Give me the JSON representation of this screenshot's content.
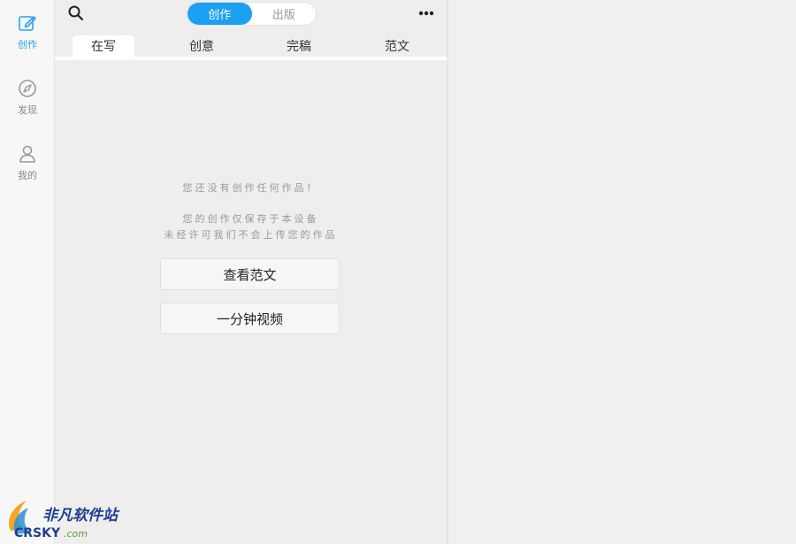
{
  "sidebar": {
    "items": [
      {
        "label": "创作",
        "icon": "edit-icon"
      },
      {
        "label": "发现",
        "icon": "compass-icon"
      },
      {
        "label": "我的",
        "icon": "user-icon"
      }
    ]
  },
  "topbar": {
    "segment": [
      "创作",
      "出版"
    ],
    "search_icon": "search-icon",
    "more_icon": "more-icon"
  },
  "tabs": [
    "在写",
    "创意",
    "完稿",
    "范文"
  ],
  "empty": {
    "line1": "您还没有创作任何作品！",
    "line2": "您的创作仅保存于本设备",
    "line3": "未经许可我们不会上传您的作品"
  },
  "buttons": {
    "view_samples": "查看范文",
    "one_min_video": "一分钟视频"
  },
  "watermark": {
    "cn": "非凡软件站",
    "en": "CRSKY",
    "tld": ".com"
  },
  "colors": {
    "accent": "#1ba0f2",
    "sidebar_active": "#2aa2ef"
  }
}
